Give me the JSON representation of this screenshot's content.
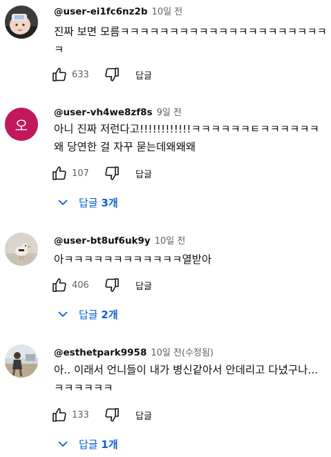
{
  "comments": [
    {
      "author": "@user-ei1fc6nz2b",
      "time": "10일 전",
      "text": "진짜 보면 모름ㅋㅋㅋㅋㅋㅋㅋㅋㅋㅋㅋㅋㅋㅋㅋㅋㅋㅋㅋㅋㅋㅋ",
      "likes": "633",
      "reply_label": "답글",
      "avatar_icon": "baby-photo-avatar"
    },
    {
      "author": "@user-vh4we8zf8s",
      "time": "9일 전",
      "text": "아니 진짜 저런다고!!!!!!!!!!!!ㅋㅋㅋㅋㅋㅋㅌㅋㅋㅋㅋㅋㅋ 왜 당연한 걸 자꾸 묻는데왜왜왜",
      "likes": "107",
      "reply_label": "답글",
      "avatar_letter": "오",
      "avatar_color": "#c2185b",
      "replies_label": "답글",
      "replies_count": "3개"
    },
    {
      "author": "@user-bt8uf6uk9y",
      "time": "10일 전",
      "text": "아ㅋㅋㅋㅋㅋㅋㅋㅋㅋㅋㅋㅋ열받아",
      "likes": "406",
      "reply_label": "답글",
      "avatar_icon": "bird-photo-avatar",
      "replies_label": "답글",
      "replies_count": "2개"
    },
    {
      "author": "@esthetpark9958",
      "time": "10일 전(수정됨)",
      "text": "아.. 이래서 언니들이 내가 병신같아서 안데리고 다녔구나... ㅋㅋㅋㅋㅋㅋ",
      "likes": "133",
      "reply_label": "답글",
      "avatar_icon": "beach-photo-avatar",
      "replies_label": "답글",
      "replies_count": "1개"
    }
  ],
  "colors": {
    "link_blue": "#065fd4",
    "meta_gray": "#606060",
    "text": "#0f0f0f"
  }
}
